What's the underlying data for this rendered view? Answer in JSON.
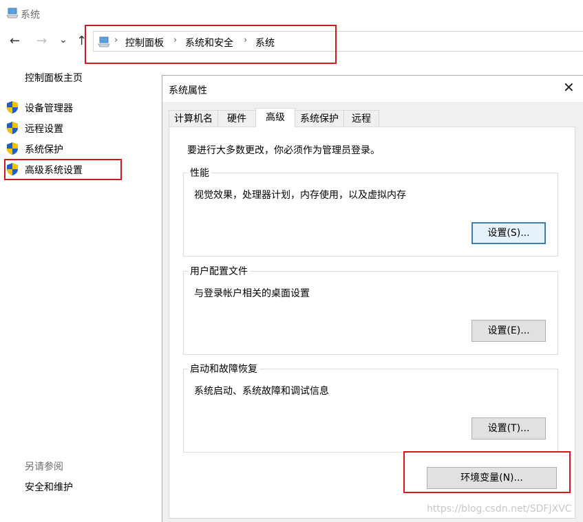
{
  "window": {
    "title": "系统",
    "icon": "computer-icon"
  },
  "nav": {
    "back": "←",
    "forward": "→",
    "recent": "⌄",
    "up": "↑",
    "breadcrumb": [
      "控制面板",
      "系统和安全",
      "系统"
    ],
    "breadcrumb_sep": "›"
  },
  "left_panel": {
    "home": "控制面板主页",
    "items": [
      {
        "label": "设备管理器",
        "icon": "uac-shield-icon"
      },
      {
        "label": "远程设置",
        "icon": "uac-shield-icon"
      },
      {
        "label": "系统保护",
        "icon": "uac-shield-icon"
      },
      {
        "label": "高级系统设置",
        "icon": "uac-shield-icon"
      }
    ],
    "see_also": "另请参阅",
    "see_also_items": [
      "安全和维护"
    ]
  },
  "dialog": {
    "title": "系统属性",
    "close": "✕",
    "tabs": [
      "计算机名",
      "硬件",
      "高级",
      "系统保护",
      "远程"
    ],
    "active_tab": "高级",
    "notice": "要进行大多数更改，你必须作为管理员登录。",
    "groups": [
      {
        "title": "性能",
        "desc": "视觉效果，处理器计划，内存使用，以及虚拟内存",
        "button": "设置(S)..."
      },
      {
        "title": "用户配置文件",
        "desc": "与登录帐户相关的桌面设置",
        "button": "设置(E)..."
      },
      {
        "title": "启动和故障恢复",
        "desc": "系统启动、系统故障和调试信息",
        "button": "设置(T)..."
      }
    ],
    "env_button": "环境变量(N)..."
  },
  "watermark": "https://blog.csdn.net/SDFJXVC",
  "colors": {
    "highlight_box": "#d4171a",
    "default_button_border": "#3c7fb1",
    "shield_blue": "#1f5fbf",
    "shield_yellow": "#f2c200"
  }
}
